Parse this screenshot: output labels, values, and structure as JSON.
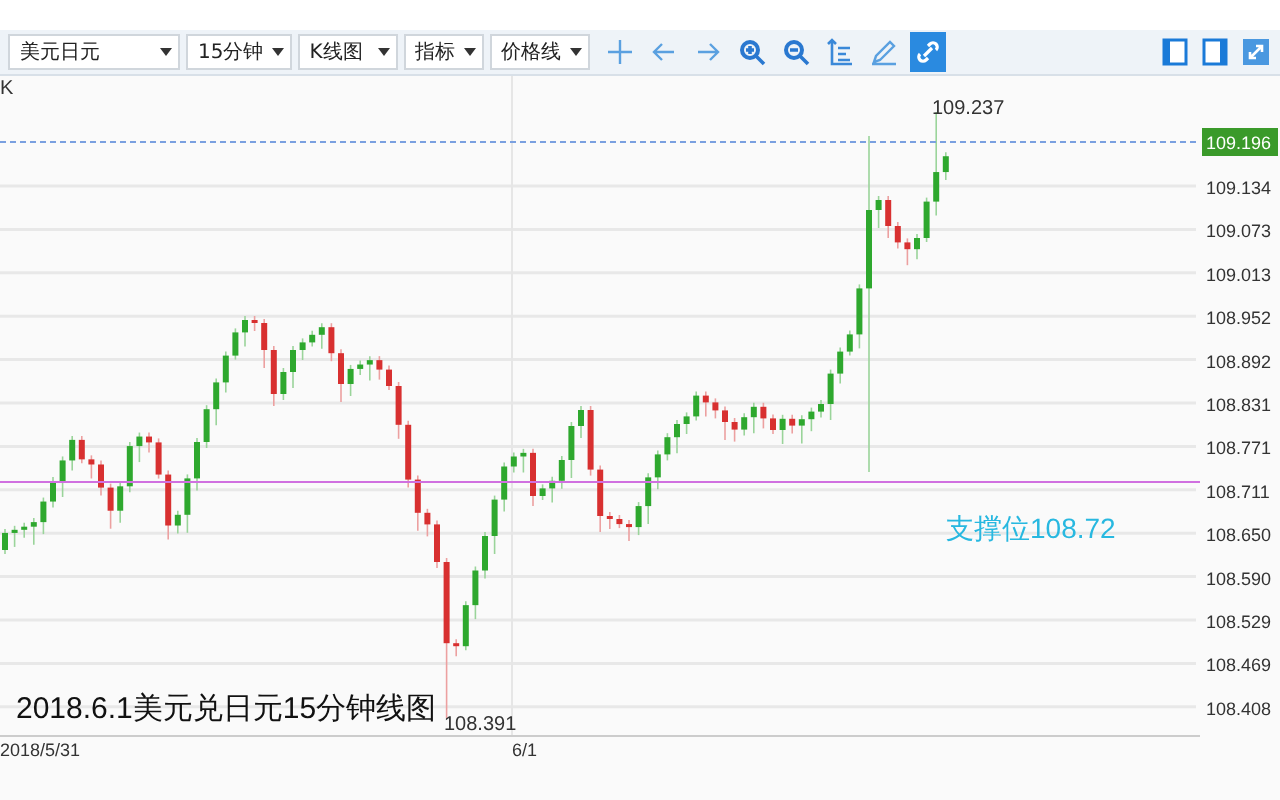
{
  "toolbar": {
    "dropdowns": [
      {
        "label": "美元日元"
      },
      {
        "label": "15分钟"
      },
      {
        "label": "K线图"
      },
      {
        "label": "指标"
      },
      {
        "label": "价格线"
      }
    ],
    "tools": [
      {
        "kind": "crosshair",
        "selected": false
      },
      {
        "kind": "left",
        "selected": false
      },
      {
        "kind": "right",
        "selected": false
      },
      {
        "kind": "zoomin",
        "selected": false
      },
      {
        "kind": "zoomout",
        "selected": false
      },
      {
        "kind": "axis",
        "selected": false
      },
      {
        "kind": "pencil",
        "selected": false
      },
      {
        "kind": "link",
        "selected": true
      }
    ],
    "layout_buttons": [
      {
        "kind": "left-panel"
      },
      {
        "kind": "right-panel"
      },
      {
        "kind": "expand"
      }
    ]
  },
  "chart": {
    "corner_label": "K",
    "price_axis": [
      "109.134",
      "109.073",
      "109.013",
      "108.952",
      "108.892",
      "108.831",
      "108.771",
      "108.711",
      "108.650",
      "108.590",
      "108.529",
      "108.469",
      "108.408"
    ],
    "current_price": "109.196",
    "high_label": "109.237",
    "low_label": "108.391",
    "dates": [
      "2018/5/31",
      "6/1"
    ],
    "support_label": "支撑位108.72",
    "caption": "2018.6.1美元兑日元15分钟线图"
  }
}
